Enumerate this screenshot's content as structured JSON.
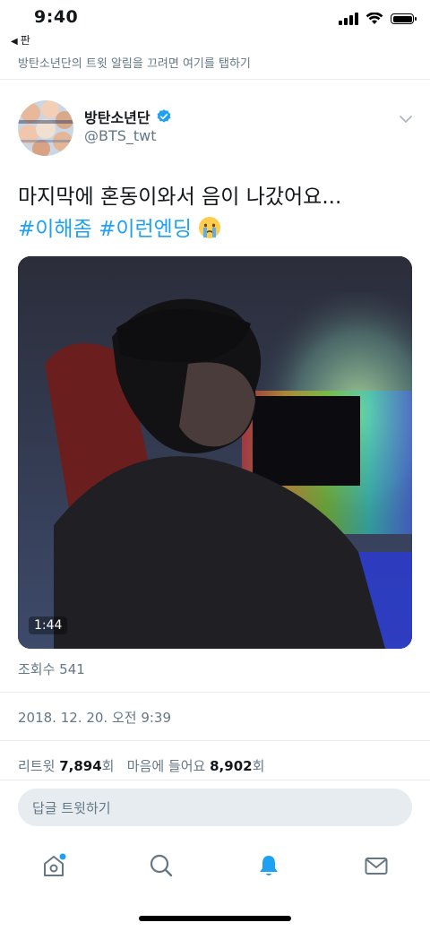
{
  "status_bar": {
    "time": "9:40",
    "back_app": "판",
    "icons": [
      "signal-icon",
      "wifi-icon",
      "battery-icon"
    ]
  },
  "notice": "방탄소년단의 트윗 알림을 끄려면 여기를 탭하기",
  "author": {
    "name": "방탄소년단",
    "handle": "@BTS_twt",
    "verified": true
  },
  "tweet": {
    "text": "마지막에 혼동이와서 음이 나갔어요...",
    "hashtags": "#이해좀 #이런엔딩",
    "emoji": "crying-face-emoji"
  },
  "video": {
    "duration": "1:44"
  },
  "meta": {
    "views": "조회수 541",
    "timestamp": "2018. 12. 20. 오전 9:39"
  },
  "stats": {
    "retweets_label": "리트윗",
    "retweets_count": "7,894",
    "retweets_unit": "회",
    "likes_label": "마음에 들어요",
    "likes_count": "8,902",
    "likes_unit": "회"
  },
  "reply": {
    "placeholder": "답글 트윗하기"
  },
  "tabs": [
    "home-icon",
    "search-icon",
    "notifications-icon",
    "messages-icon"
  ],
  "colors": {
    "accent": "#1da1f2",
    "secondary_text": "#657786",
    "divider": "#e6ecf0"
  }
}
